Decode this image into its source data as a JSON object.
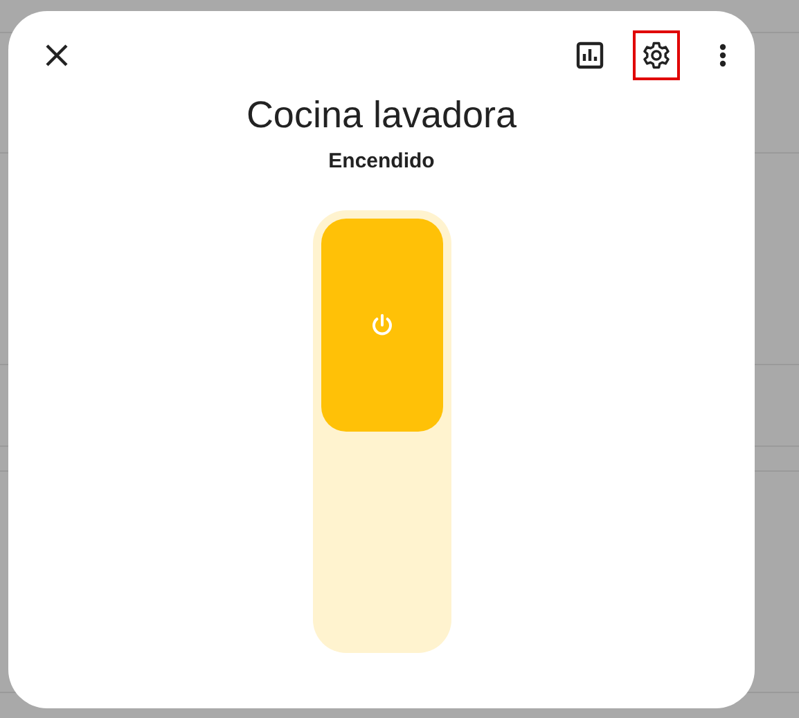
{
  "dialog": {
    "title": "Cocina lavadora",
    "state": "Encendido",
    "on": true
  },
  "header_actions": [
    {
      "kind": "history",
      "highlighted": false
    },
    {
      "kind": "settings",
      "highlighted": true
    },
    {
      "kind": "more",
      "highlighted": false
    }
  ]
}
